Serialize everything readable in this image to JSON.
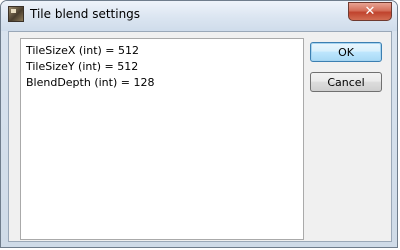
{
  "window": {
    "title": "Tile blend settings",
    "close_label": "✕"
  },
  "settings": {
    "lines": [
      "TileSizeX (int) = 512",
      "TileSizeY (int) = 512",
      "BlendDepth (int) = 128"
    ]
  },
  "buttons": {
    "ok_label": "OK",
    "cancel_label": "Cancel"
  }
}
